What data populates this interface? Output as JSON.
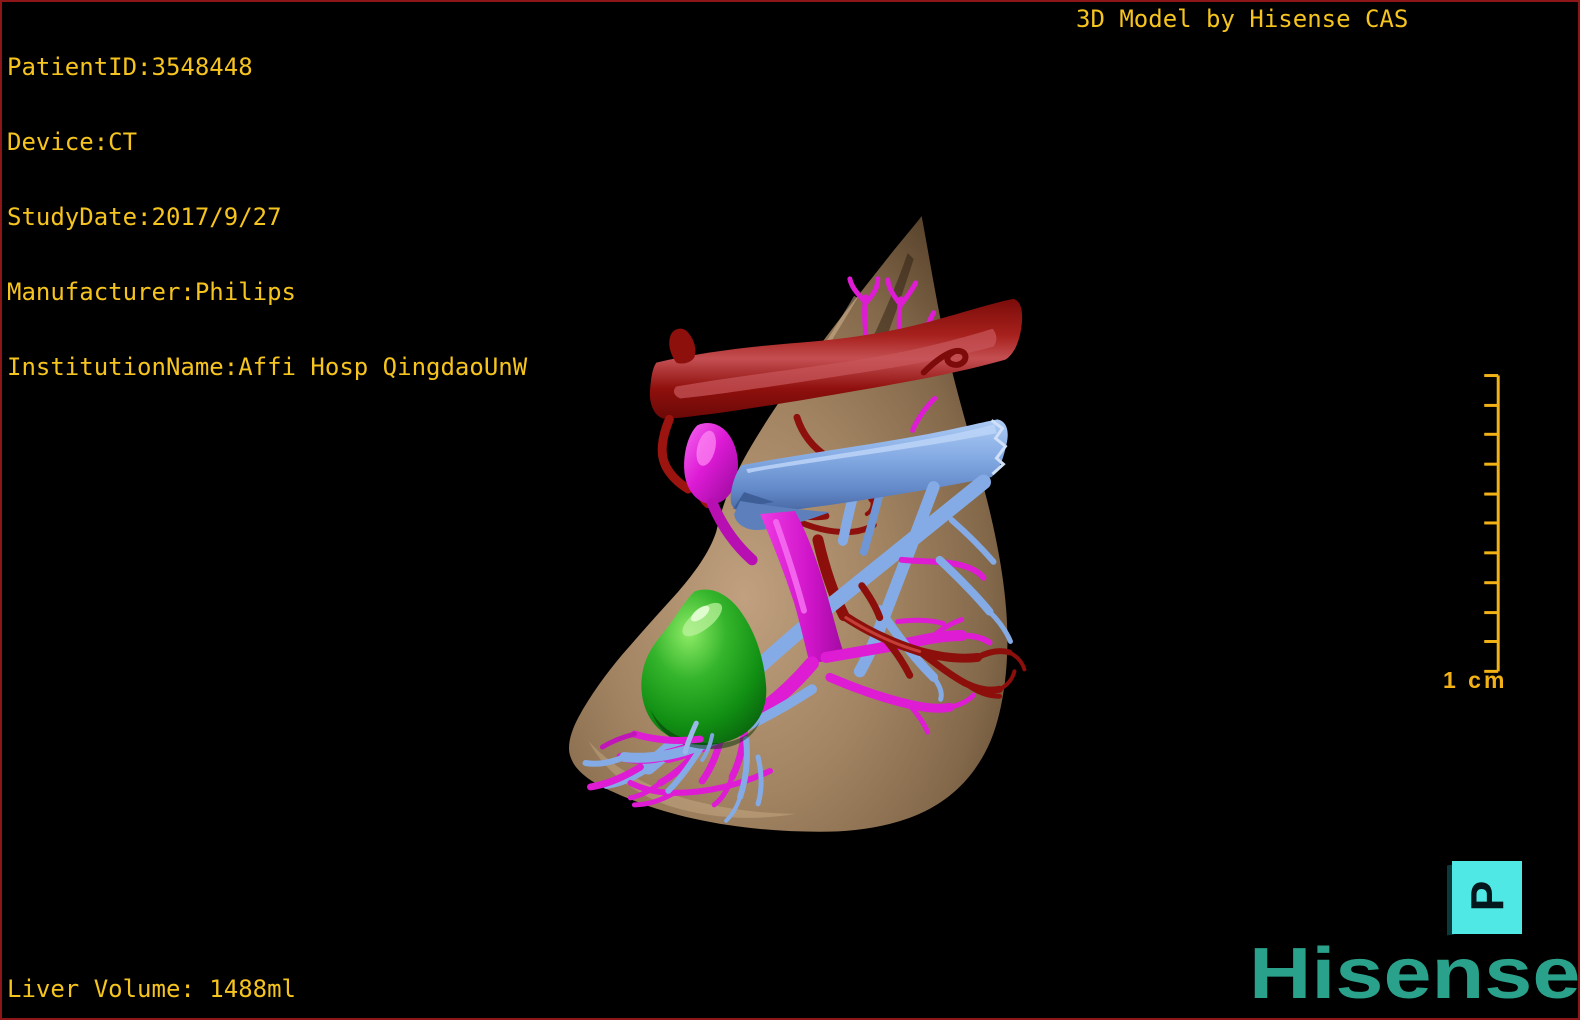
{
  "window": {
    "background": "#000000",
    "border_color": "#8c1618"
  },
  "overlay": {
    "text_color": "#f6c41e",
    "patient_info": {
      "lines": [
        "PatientID:3548448",
        "Device:CT",
        "StudyDate:2017/9/27",
        "Manufacturer:Philips",
        "InstitutionName:Affi Hosp QingdaoUnW"
      ]
    },
    "title": "3D Model by Hisense CAS",
    "liver_volume": "Liver Volume: 1488ml"
  },
  "scale_bar": {
    "label": "1 cm",
    "segments": 10,
    "color": "#f2b216"
  },
  "orientation_cube": {
    "letter": "P",
    "face_color": "#4fe8e4",
    "side_color": "#0b3a3a",
    "letter_color": "#04171c"
  },
  "brand": {
    "logo_text": "Hisense",
    "color": "#2aa18b"
  },
  "model": {
    "structures": [
      {
        "name": "liver",
        "color": "#a0835f"
      },
      {
        "name": "hepatic artery (red)",
        "color": "#9e1410"
      },
      {
        "name": "portal vein (magenta)",
        "color": "#dd1cd4"
      },
      {
        "name": "hepatic vein (light blue)",
        "color": "#84abe6"
      },
      {
        "name": "gallbladder (green)",
        "color": "#169616"
      }
    ]
  }
}
